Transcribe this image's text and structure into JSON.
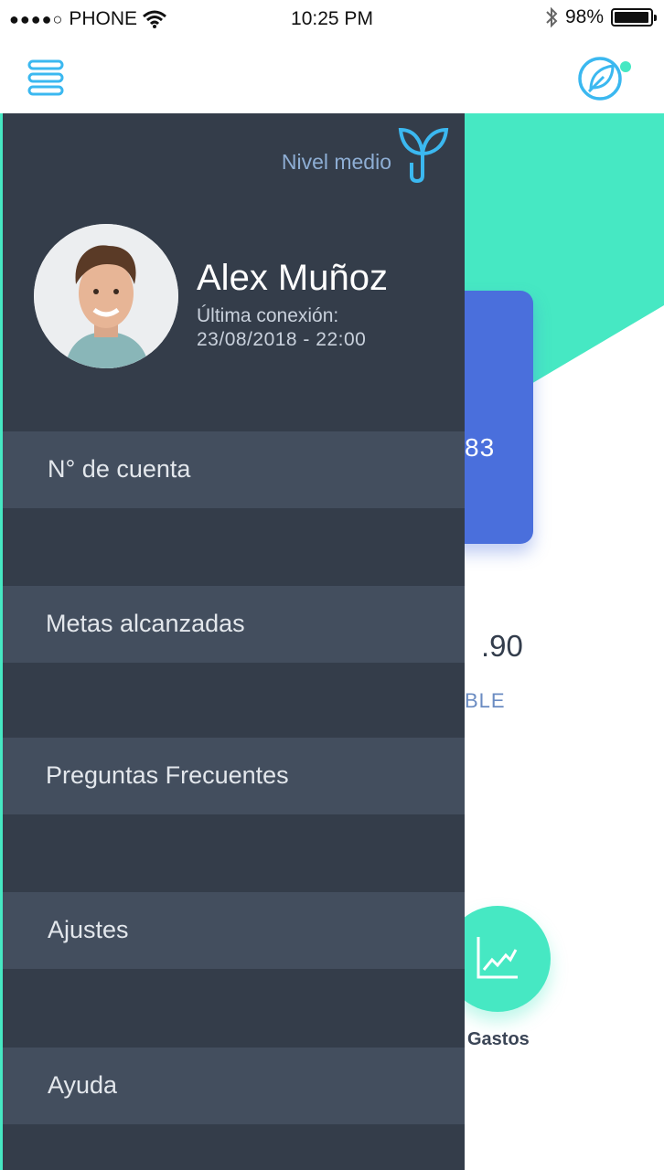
{
  "status_bar": {
    "carrier": "PHONE",
    "time": "10:25 PM",
    "battery": "98%",
    "battery_level": 0.98
  },
  "header": {
    "menu_icon": "menu-icon",
    "profile_icon": "leaf-icon",
    "notification_color": "#46e8c3"
  },
  "background": {
    "card_number": "83",
    "amount": ".90",
    "available_label": "BLE",
    "expenses_label": "Gastos"
  },
  "drawer": {
    "level": "Nivel medio",
    "level_icon": "sprout-icon",
    "user_name": "Alex Muñoz",
    "last_login_label": "Última conexión:",
    "last_login_value": "23/08/2018 - 22:00",
    "items": [
      {
        "label": "N° de cuenta"
      },
      {
        "label": "Metas alcanzadas"
      },
      {
        "label": "Preguntas Frecuentes"
      },
      {
        "label": "Ajustes"
      },
      {
        "label": "Ayuda"
      }
    ]
  },
  "colors": {
    "accent": "#46e8c3",
    "drawer_bg": "#343d4a",
    "drawer_item_bg": "#434e5e",
    "card_blue": "#4a6fdc",
    "icon_blue": "#3bb8f0"
  }
}
